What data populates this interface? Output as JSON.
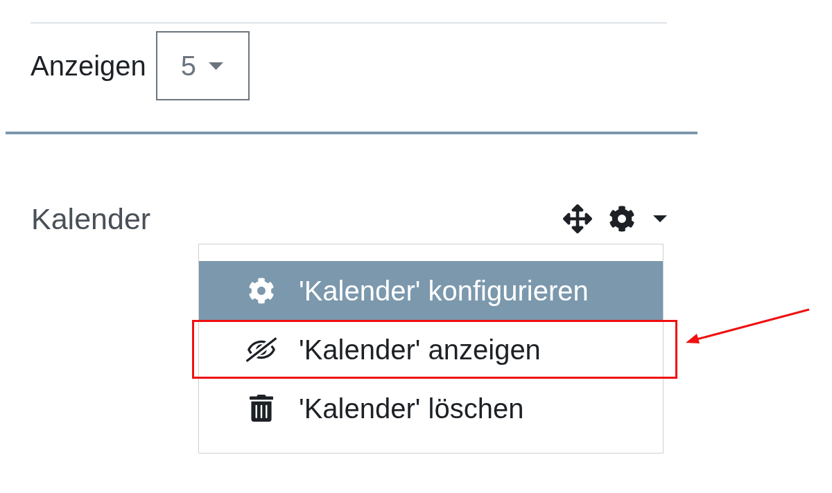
{
  "page_size": {
    "label": "Anzeigen",
    "value": "5"
  },
  "block": {
    "title": "Kalender",
    "menu": {
      "expanded": true,
      "items": [
        {
          "kind": "configure",
          "label": "'Kalender' konfigurieren",
          "selected": true,
          "annotated": false
        },
        {
          "kind": "show",
          "label": "'Kalender' anzeigen",
          "selected": false,
          "annotated": true
        },
        {
          "kind": "delete",
          "label": "'Kalender' löschen",
          "selected": false,
          "annotated": false
        }
      ]
    }
  }
}
